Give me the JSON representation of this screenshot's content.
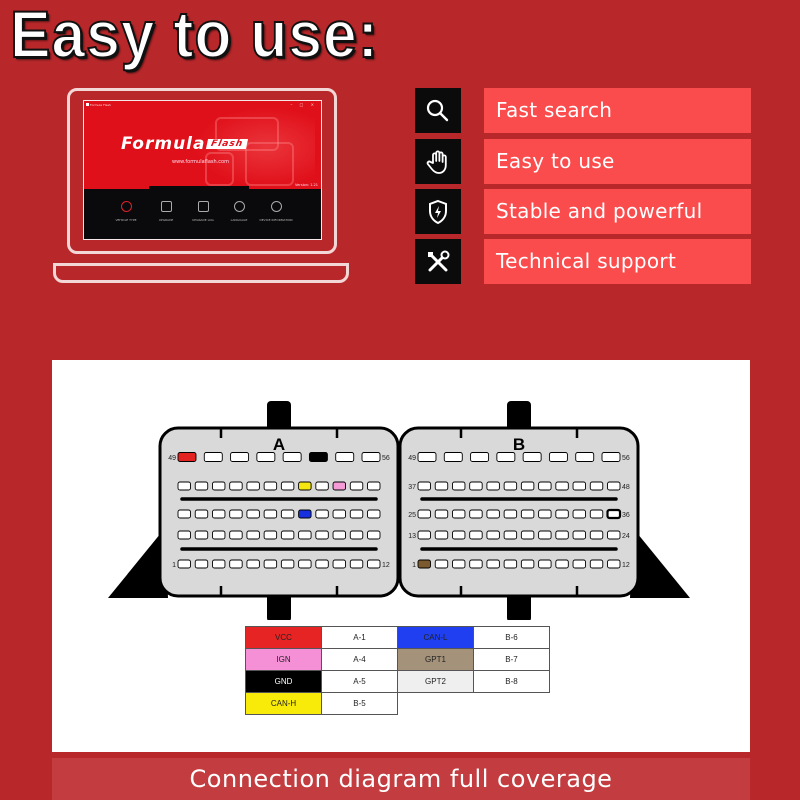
{
  "headline": "Easy to use:",
  "laptop_screen": {
    "window_title": "Formula Flash",
    "window_controls": "– □ ×",
    "logo_main": "Formula",
    "logo_badge": "Flash",
    "website": "www.formulaflash.com",
    "version": "Version: 1.21",
    "dock": [
      {
        "label": "VEHICLE TYPE",
        "icon": "vehicle-icon",
        "active": true
      },
      {
        "label": "UPGRADE",
        "icon": "upgrade-arrow-icon",
        "active": false
      },
      {
        "label": "UPGRADE LOG",
        "icon": "document-icon",
        "active": false
      },
      {
        "label": "LANGUAGE",
        "icon": "language-icon",
        "active": false
      },
      {
        "label": "DEVICE INFORMATION",
        "icon": "device-info-icon",
        "active": false
      }
    ]
  },
  "features": [
    {
      "label": "Fast search",
      "icon": "search-icon"
    },
    {
      "label": "Easy to use",
      "icon": "hand-icon"
    },
    {
      "label": "Stable and powerful",
      "icon": "shield-lightning-icon"
    },
    {
      "label": "Technical support",
      "icon": "tools-icon"
    }
  ],
  "connectors": [
    {
      "name": "A",
      "row_labels": [
        {
          "row": 0,
          "left": "49",
          "right": "56"
        },
        {
          "row": 4,
          "left": "1",
          "right": "12"
        }
      ],
      "highlighted_pins": [
        {
          "row": 0,
          "col": 0,
          "color": "#e32222"
        },
        {
          "row": 0,
          "col": 5,
          "color": "#000000"
        },
        {
          "row": 1,
          "col": 7,
          "color": "#f5e612"
        },
        {
          "row": 1,
          "col": 9,
          "color": "#f49ad6"
        },
        {
          "row": 2,
          "col": 7,
          "color": "#1630e0"
        }
      ]
    },
    {
      "name": "B",
      "row_labels": [
        {
          "row": 0,
          "left": "49",
          "right": "56"
        },
        {
          "row": 1,
          "left": "37",
          "right": "48"
        },
        {
          "row": 2,
          "left": "25",
          "right": "36"
        },
        {
          "row": 3,
          "left": "13",
          "right": "24"
        },
        {
          "row": 4,
          "left": "1",
          "right": "12"
        }
      ],
      "highlighted_pins": [
        {
          "row": 2,
          "col": 11,
          "color": "#ffffff",
          "bold": true
        },
        {
          "row": 4,
          "col": 0,
          "color": "#7a5a2e"
        }
      ]
    }
  ],
  "legend": [
    [
      {
        "signal": "VCC",
        "color": "#e72424",
        "text_color": "#222"
      },
      {
        "pin": "A-1"
      },
      {
        "signal": "CAN-L",
        "color": "#1f3ff0",
        "text_color": "#222"
      },
      {
        "pin": "B-6"
      }
    ],
    [
      {
        "signal": "IGN",
        "color": "#f58fd6",
        "text_color": "#222"
      },
      {
        "pin": "A-4"
      },
      {
        "signal": "GPT1",
        "color": "#a5927a",
        "text_color": "#222"
      },
      {
        "pin": "B-7"
      }
    ],
    [
      {
        "signal": "GND",
        "color": "#000000",
        "text_color": "#fff"
      },
      {
        "pin": "A-5"
      },
      {
        "signal": "GPT2",
        "color": "#efefef",
        "text_color": "#222"
      },
      {
        "pin": "B-8"
      }
    ],
    [
      {
        "signal": "CAN-H",
        "color": "#f8ea09",
        "text_color": "#222"
      },
      {
        "pin": "B-5"
      }
    ]
  ],
  "caption": "Connection diagram full coverage"
}
